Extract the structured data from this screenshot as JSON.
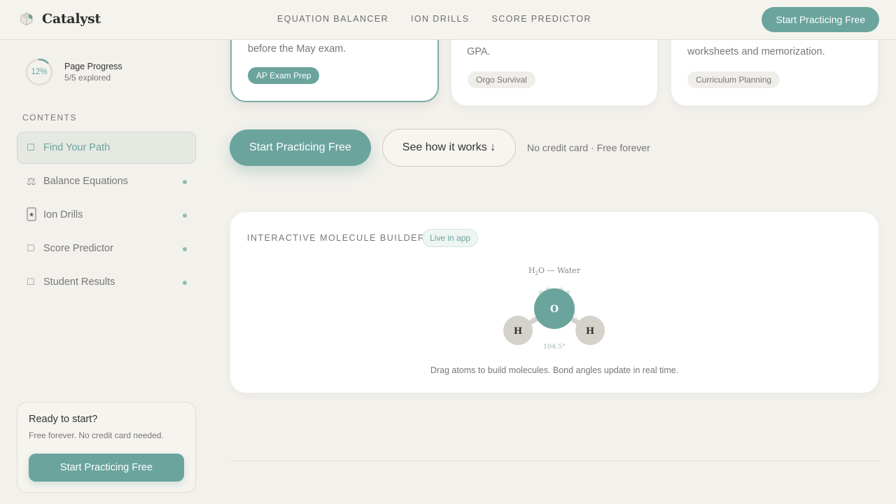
{
  "header": {
    "logo_text": "Catalyst",
    "nav": [
      "EQUATION BALANCER",
      "ION DRILLS",
      "SCORE PREDICTOR"
    ],
    "cta": "Start Practicing Free"
  },
  "sidebar": {
    "progress": {
      "percent_label": "12%",
      "percent": 12,
      "title": "Page Progress",
      "subtitle": "5/5 explored"
    },
    "contents_label": "CONTENTS",
    "items": [
      {
        "label": "Find Your Path",
        "icon": "compass-icon",
        "active": true
      },
      {
        "label": "Balance Equations",
        "icon": "scale-icon",
        "active": false
      },
      {
        "label": "Ion Drills",
        "icon": "star-card-icon",
        "active": false
      },
      {
        "label": "Score Predictor",
        "icon": "chart-icon",
        "active": false
      },
      {
        "label": "Student Results",
        "icon": "trophy-icon",
        "active": false
      }
    ],
    "ready": {
      "title": "Ready to start?",
      "subtitle": "Free forever. No credit card needed.",
      "button": "Start Practicing Free"
    }
  },
  "cards": [
    {
      "text": "before the May exam.",
      "tag": "AP Exam Prep"
    },
    {
      "text": "GPA.",
      "tag": "Orgo Survival"
    },
    {
      "text": "worksheets and memorization.",
      "tag": "Curriculum Planning"
    }
  ],
  "cta_row": {
    "primary": "Start Practicing Free",
    "secondary": "See how it works ↓",
    "note": "No credit card · Free forever"
  },
  "builder": {
    "title": "INTERACTIVE MOLECULE BUILDER",
    "badge": "Live in app",
    "molecule_prefix": "H",
    "molecule_sub": "2",
    "molecule_suffix": "O — Water",
    "atom_center": "O",
    "atom_left": "H",
    "atom_right": "H",
    "angle": "104.5°",
    "caption": "Drag atoms to build molecules. Bond angles update in real time."
  },
  "colors": {
    "accent": "#6aa49d",
    "background": "#f3f1ec",
    "card": "#ffffff"
  }
}
